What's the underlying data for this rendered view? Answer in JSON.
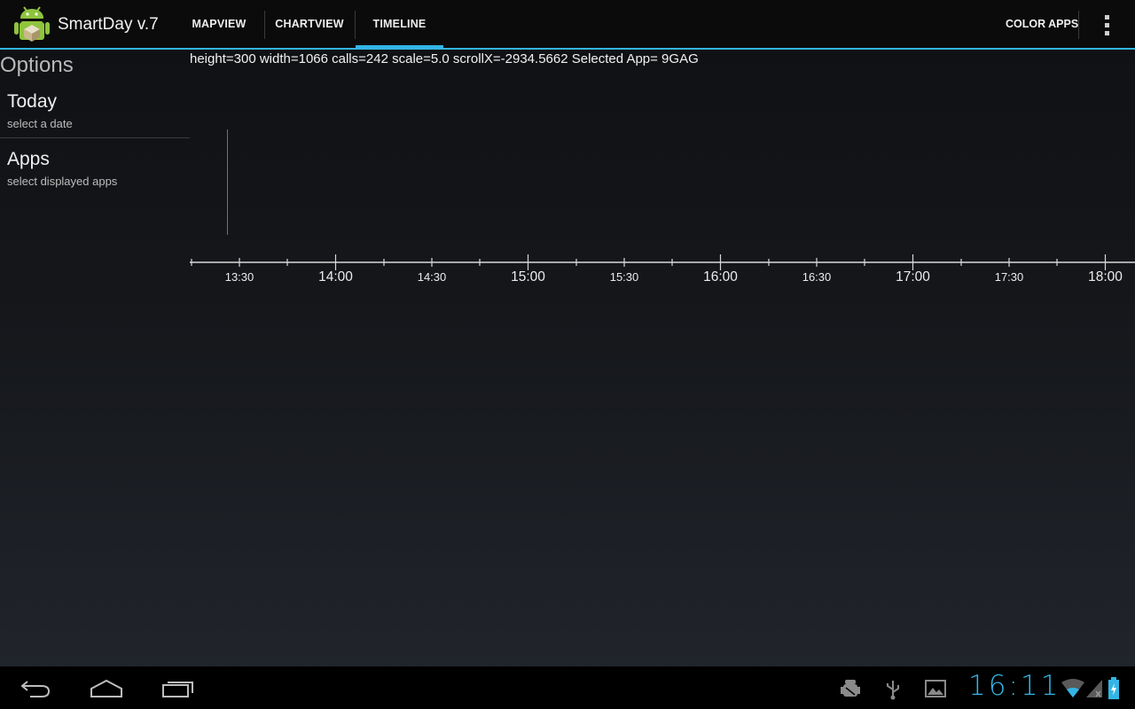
{
  "app": {
    "title": "SmartDay v.7"
  },
  "tabs": [
    {
      "label": "MAPVIEW"
    },
    {
      "label": "CHARTVIEW"
    },
    {
      "label": "TIMELINE",
      "selected": true
    }
  ],
  "actions": {
    "color_apps": "COLOR APPS"
  },
  "sidebar": {
    "title": "Options",
    "items": [
      {
        "title": "Today",
        "subtitle": "select a date"
      },
      {
        "title": "Apps",
        "subtitle": "select displayed apps"
      }
    ]
  },
  "debug_text": "height=300 width=1066 calls=242 scale=5.0 scrollX=-2934.5662 Selected App= 9GAG",
  "timeline": {
    "major_labels": [
      "14:00",
      "15:00",
      "16:00",
      "17:00",
      "18:00"
    ],
    "minor_labels": [
      "13:30",
      "14:30",
      "15:30",
      "16:30",
      "17:30"
    ],
    "event_time": "13:27"
  },
  "status": {
    "clock": "16:11"
  },
  "colors": {
    "accent": "#33b5e5",
    "event": "#c0477e"
  },
  "icons": {
    "back": "back-icon",
    "home": "home-icon",
    "recents": "recent-apps-icon",
    "debug": "android-debug-icon",
    "usb": "usb-icon",
    "gallery": "gallery-icon",
    "wifi": "wifi-icon",
    "signal": "signal-icon",
    "battery": "battery-icon"
  }
}
